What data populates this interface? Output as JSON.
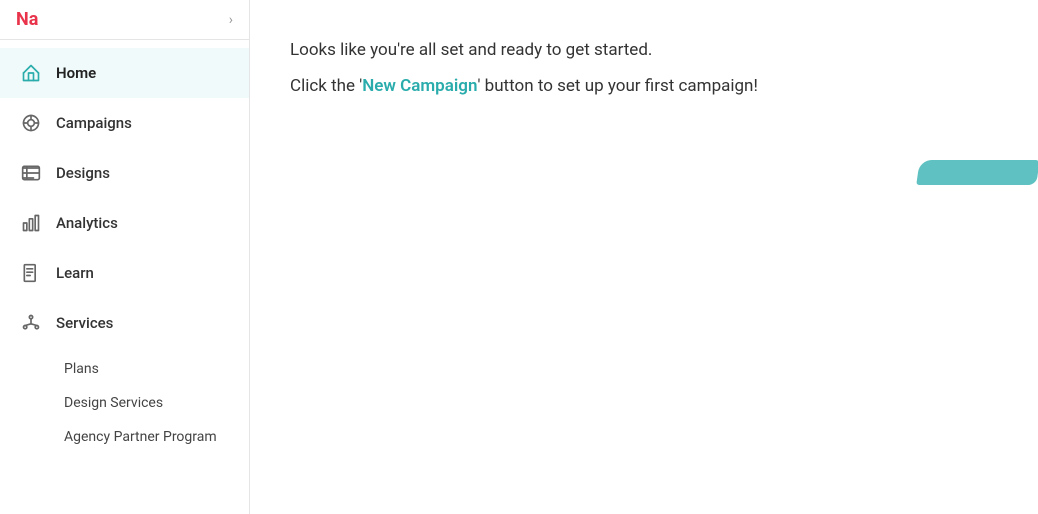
{
  "sidebar": {
    "header": {
      "logo_text": "Na",
      "chevron": "›"
    },
    "nav_items": [
      {
        "id": "home",
        "label": "Home",
        "icon": "home-icon",
        "active": true
      },
      {
        "id": "campaigns",
        "label": "Campaigns",
        "icon": "campaigns-icon",
        "active": false
      },
      {
        "id": "designs",
        "label": "Designs",
        "icon": "designs-icon",
        "active": false
      },
      {
        "id": "analytics",
        "label": "Analytics",
        "icon": "analytics-icon",
        "active": false
      },
      {
        "id": "learn",
        "label": "Learn",
        "icon": "learn-icon",
        "active": false
      },
      {
        "id": "services",
        "label": "Services",
        "icon": "services-icon",
        "active": false
      }
    ],
    "sub_items": [
      {
        "id": "plans",
        "label": "Plans"
      },
      {
        "id": "design-services",
        "label": "Design Services"
      },
      {
        "id": "agency-partner",
        "label": "Agency Partner Program"
      }
    ]
  },
  "main": {
    "line1": "Looks like you're all set and ready to get started.",
    "line2_prefix": "Click the '",
    "line2_link": "New Campaign",
    "line2_suffix": "' button to set up your first campaign!"
  }
}
